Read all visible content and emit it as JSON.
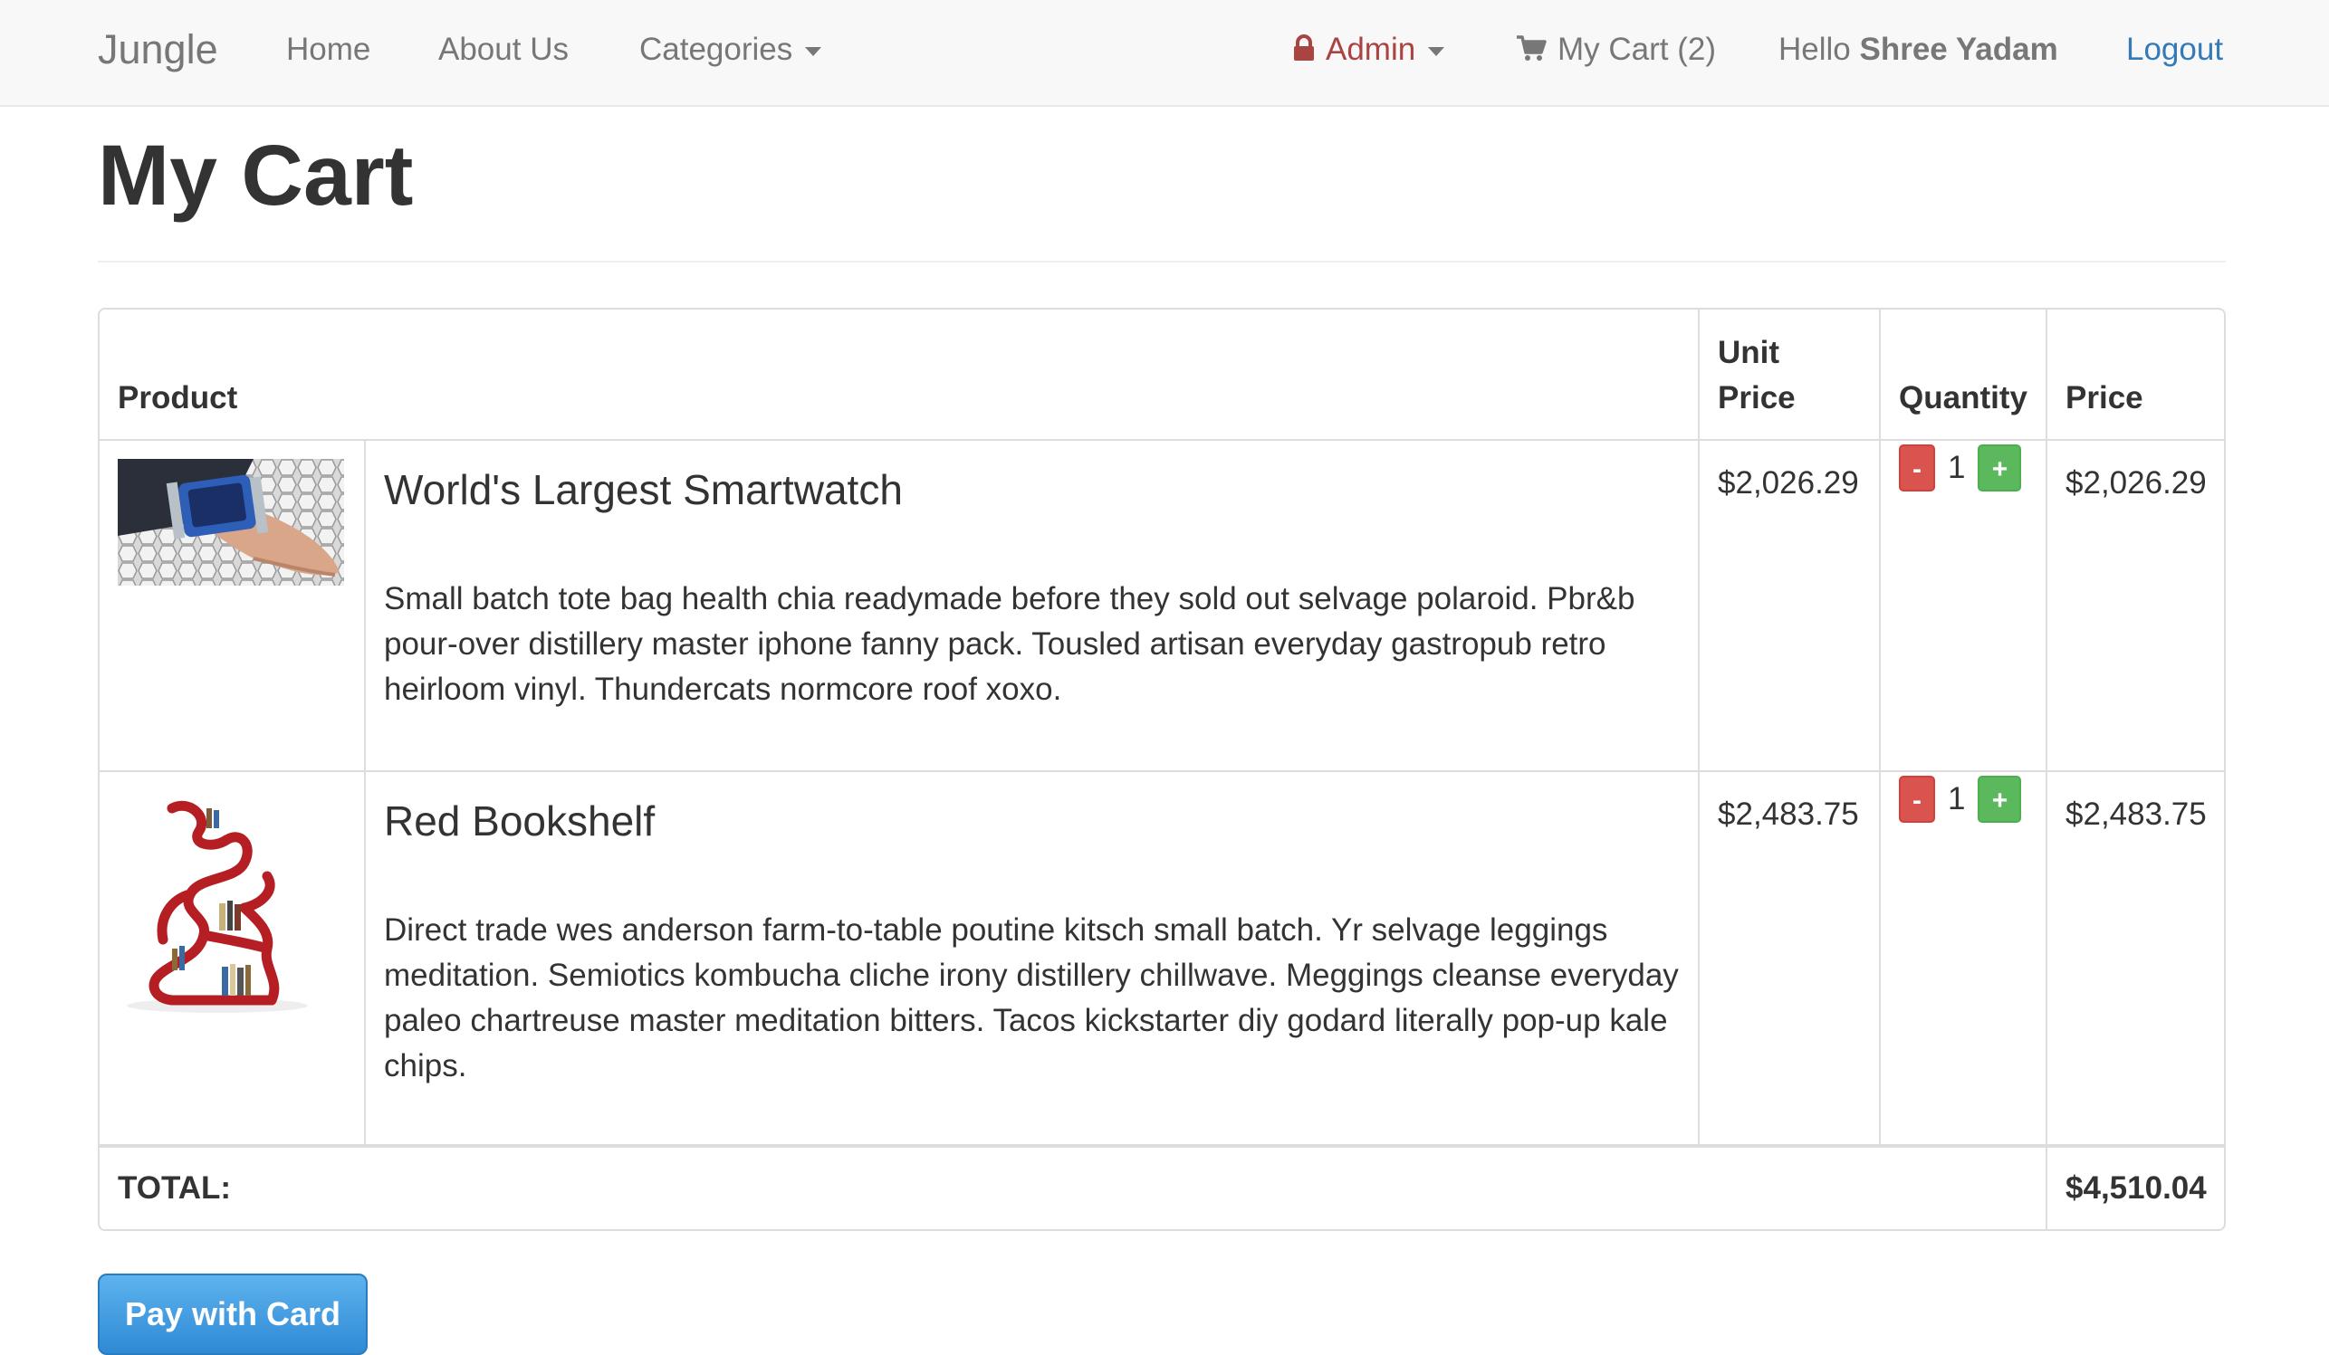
{
  "navbar": {
    "brand": "Jungle",
    "home": "Home",
    "about": "About Us",
    "categories": "Categories",
    "admin": "Admin",
    "cart": "My Cart (2)",
    "hello_prefix": "Hello",
    "user_name": "Shree Yadam",
    "logout": "Logout"
  },
  "page": {
    "title": "My Cart"
  },
  "table": {
    "headers": {
      "product": "Product",
      "unit_price_line1": "Unit",
      "unit_price_line2": "Price",
      "quantity": "Quantity",
      "price": "Price"
    },
    "items": [
      {
        "name": "World's Largest Smartwatch",
        "description": "Small batch tote bag health chia readymade before they sold out selvage polaroid. Pbr&b pour-over distillery master iphone fanny pack. Tousled artisan everyday gastropub retro heirloom vinyl. Thundercats normcore roof xoxo.",
        "unit_price": "$2,026.29",
        "quantity": "1",
        "price": "$2,026.29"
      },
      {
        "name": "Red Bookshelf",
        "description": "Direct trade wes anderson farm-to-table poutine kitsch small batch. Yr selvage leggings meditation. Semiotics kombucha cliche irony distillery chillwave. Meggings cleanse everyday paleo chartreuse master meditation bitters. Tacos kickstarter diy godard literally pop-up kale chips.",
        "unit_price": "$2,483.75",
        "quantity": "1",
        "price": "$2,483.75"
      }
    ],
    "minus_label": "-",
    "plus_label": "+",
    "total_label": "TOTAL:",
    "total_value": "$4,510.04"
  },
  "pay_button": "Pay with Card",
  "colors": {
    "danger": "#d9534f",
    "success": "#5cb85c",
    "link": "#337ab7",
    "admin": "#a94442",
    "primary_button": "#3a95dc"
  },
  "icons": {
    "admin": "lock-icon",
    "cart": "shopping-cart-icon"
  }
}
